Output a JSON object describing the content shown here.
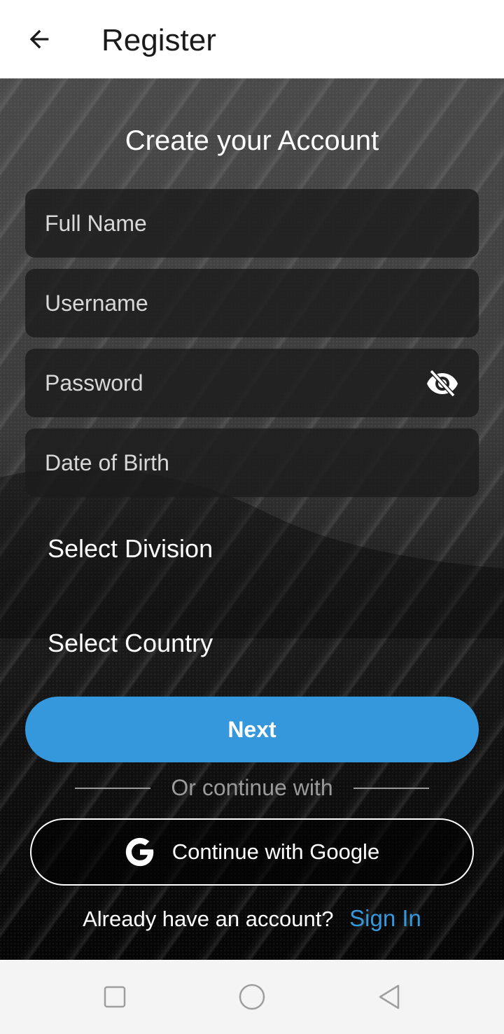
{
  "appbar": {
    "title": "Register",
    "back_icon": "arrow-left-icon"
  },
  "form": {
    "heading": "Create your Account",
    "full_name_placeholder": "Full Name",
    "username_placeholder": "Username",
    "password_placeholder": "Password",
    "password_visibility_icon": "eye-off-icon",
    "dob_placeholder": "Date of Birth",
    "division_placeholder": "Select Division",
    "country_placeholder": "Select Country"
  },
  "actions": {
    "next_label": "Next",
    "divider_text": "Or continue with",
    "google_label": "Continue with Google",
    "google_icon": "google-icon",
    "signin_prompt": "Already have an account?",
    "signin_link": "Sign In"
  },
  "navbar": {
    "recents_icon": "square-icon",
    "home_icon": "circle-icon",
    "back_icon": "triangle-back-icon"
  },
  "colors": {
    "accent": "#3598dc",
    "appbar_bg": "#ffffff",
    "field_bg": "#1c1c1c",
    "navbar_bg": "#f4f4f4"
  }
}
